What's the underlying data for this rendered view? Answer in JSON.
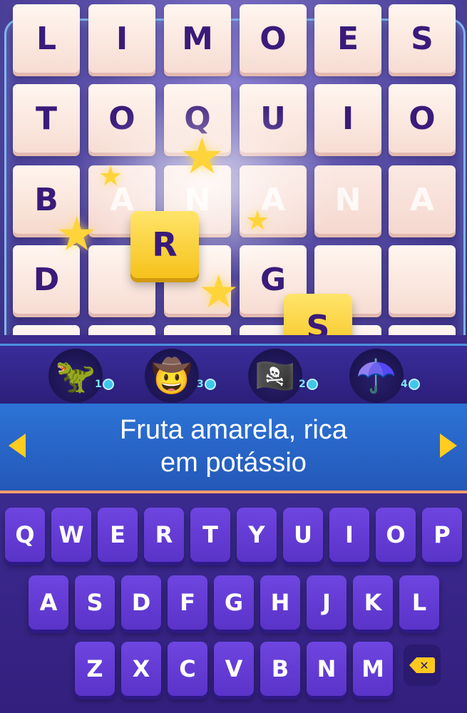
{
  "board": {
    "rows": [
      [
        "L",
        "I",
        "M",
        "O",
        "E",
        "S"
      ],
      [
        "T",
        "O",
        "Q",
        "U",
        "I",
        "O"
      ],
      [
        "B",
        "A",
        "N",
        "A",
        "N",
        "A"
      ],
      [
        "D",
        "",
        "",
        "G",
        "",
        ""
      ]
    ],
    "floating_tiles": [
      "R",
      "S"
    ]
  },
  "players": [
    {
      "icon": "dino-avatar-icon",
      "emoji": "🦖",
      "score": "1"
    },
    {
      "icon": "explorer-avatar-icon",
      "emoji": "🤠",
      "score": "3"
    },
    {
      "icon": "pirate-avatar-icon",
      "emoji": "🏴‍☠️",
      "score": "2"
    },
    {
      "icon": "umbrella-avatar-icon",
      "emoji": "☂️",
      "score": "4"
    }
  ],
  "clue": {
    "line1": "Fruta amarela, rica",
    "line2": "em potássio"
  },
  "keyboard": {
    "row1": [
      "Q",
      "W",
      "E",
      "R",
      "T",
      "Y",
      "U",
      "I",
      "O",
      "P"
    ],
    "row2": [
      "A",
      "S",
      "D",
      "F",
      "G",
      "H",
      "J",
      "K",
      "L"
    ],
    "row3": [
      "Z",
      "X",
      "C",
      "V",
      "B",
      "N",
      "M"
    ],
    "backspace_icon": "backspace-icon"
  },
  "colors": {
    "accent": "#ffcc1f",
    "tile_text": "#3a1b7a",
    "clue_bg": "#2c73d6",
    "key_bg": "#6e45e0"
  }
}
